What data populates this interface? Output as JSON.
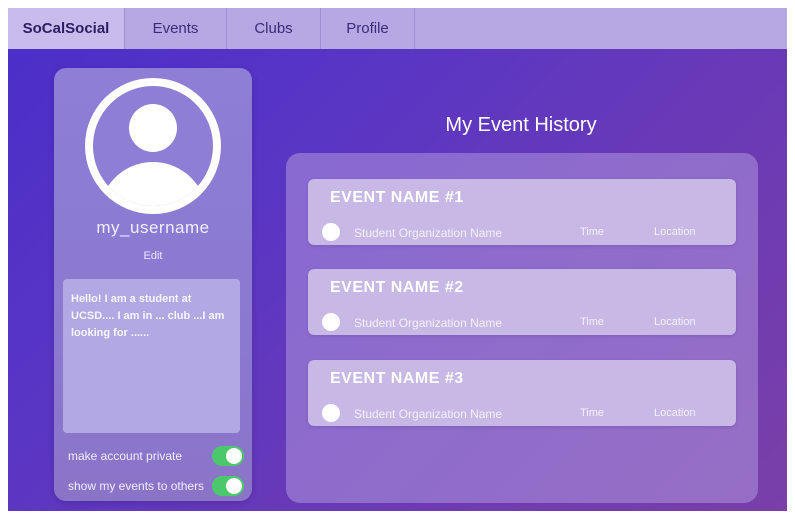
{
  "nav": {
    "brand": "SoCalSocial",
    "items": [
      {
        "label": "Events"
      },
      {
        "label": "Clubs"
      },
      {
        "label": "Profile"
      }
    ]
  },
  "profile": {
    "username": "my_username",
    "edit_label": "Edit",
    "bio": "Hello! I am a student at UCSD.... I am in ... club ...I am looking for ......",
    "toggles": [
      {
        "label": "make account private",
        "on": true
      },
      {
        "label": "show my events to others",
        "on": true
      }
    ]
  },
  "history": {
    "title": "My Event History",
    "events": [
      {
        "name": "EVENT NAME #1",
        "org": "Student Organization Name",
        "time": "Time",
        "location": "Location"
      },
      {
        "name": "EVENT NAME #2",
        "org": "Student Organization Name",
        "time": "Time",
        "location": "Location"
      },
      {
        "name": "EVENT NAME #3",
        "org": "Student Organization Name",
        "time": "Time",
        "location": "Location"
      }
    ]
  },
  "colors": {
    "toggle_on": "#4cc86c",
    "navbar": "#b7a7e3",
    "background_start": "#4a2ec9",
    "background_end": "#7a3fa8"
  }
}
